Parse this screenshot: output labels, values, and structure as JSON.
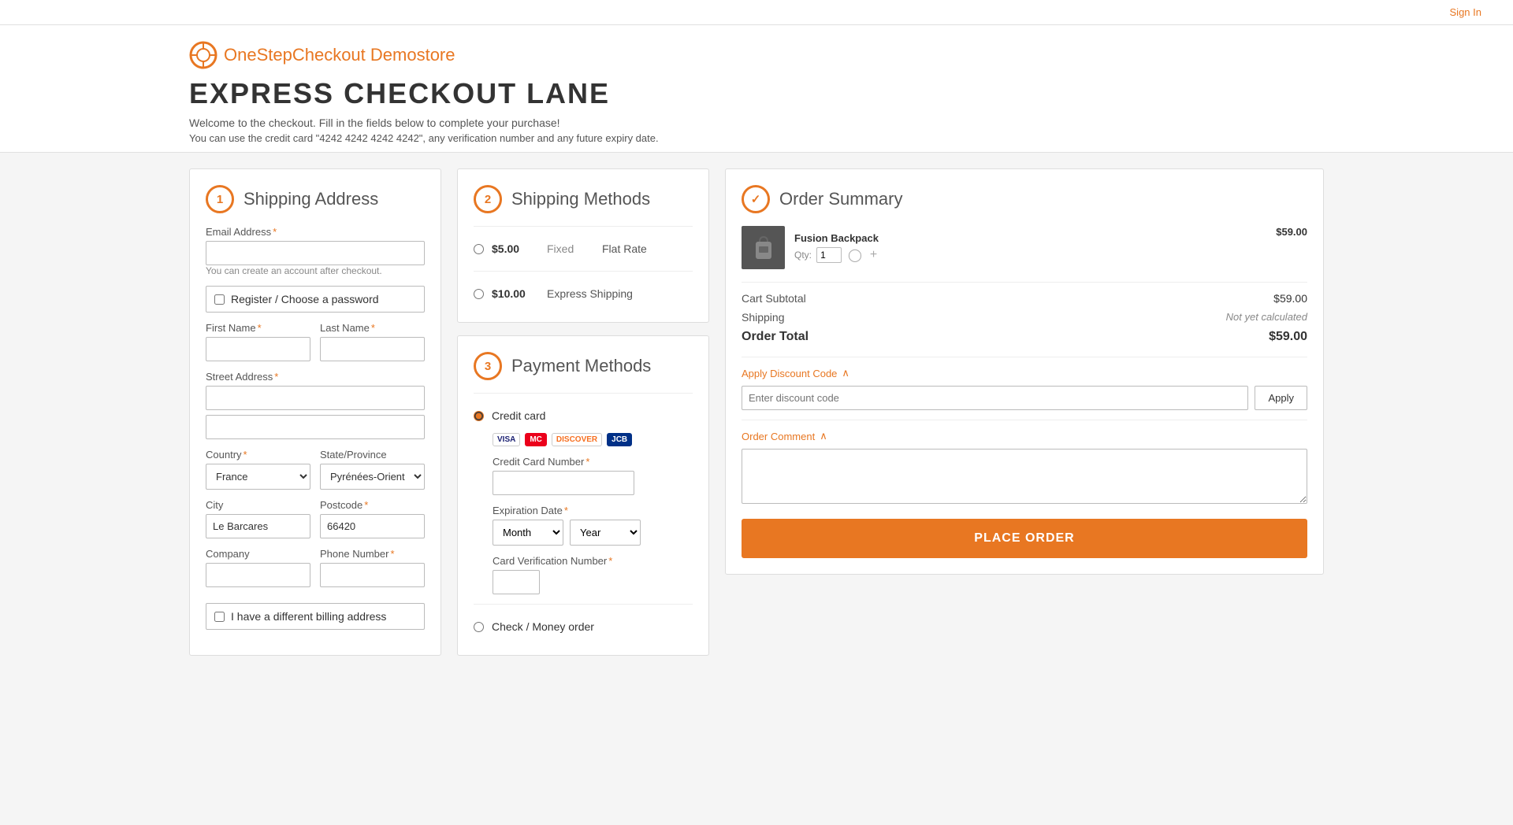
{
  "topbar": {
    "sign_in": "Sign In"
  },
  "header": {
    "logo_brand": "OneStepCheckout",
    "logo_store": " Demostore",
    "page_title": "EXPRESS CHECKOUT LANE",
    "subtitle": "Welcome to the checkout. Fill in the fields below to complete your purchase!",
    "note": "You can use the credit card \"4242 4242 4242 4242\", any verification number and any future expiry date."
  },
  "shipping_address": {
    "step": "1",
    "title": "Shipping Address",
    "email_label": "Email Address",
    "email_placeholder": "",
    "email_hint": "You can create an account after checkout.",
    "register_label": "Register / Choose a password",
    "first_name_label": "First Name",
    "last_name_label": "Last Name",
    "street_label": "Street Address",
    "country_label": "Country",
    "country_value": "France",
    "state_label": "State/Province",
    "state_value": "Pyrénées-Orientales",
    "city_label": "City",
    "city_value": "Le Barcares",
    "postcode_label": "Postcode",
    "postcode_value": "66420",
    "company_label": "Company",
    "phone_label": "Phone Number",
    "billing_label": "I have a different billing address"
  },
  "shipping_methods": {
    "step": "2",
    "title": "Shipping Methods",
    "options": [
      {
        "price": "$5.00",
        "type": "Fixed",
        "name": "Flat Rate"
      },
      {
        "price": "$10.00",
        "type": "",
        "name": "Express Shipping"
      }
    ]
  },
  "payment_methods": {
    "step": "3",
    "title": "Payment Methods",
    "credit_card_label": "Credit card",
    "cc_logos": [
      "VISA",
      "MC",
      "DISC",
      "JCB"
    ],
    "cc_number_label": "Credit Card Number",
    "exp_date_label": "Expiration Date",
    "month_placeholder": "Month",
    "year_placeholder": "Year",
    "cvv_label": "Card Verification Number",
    "check_label": "Check / Money order"
  },
  "order_summary": {
    "step_icon": "✓",
    "title": "Order Summary",
    "product_name": "Fusion Backpack",
    "product_qty": "1",
    "product_price": "$59.00",
    "cart_subtotal_label": "Cart Subtotal",
    "cart_subtotal_value": "$59.00",
    "shipping_label": "Shipping",
    "shipping_value": "Not yet calculated",
    "order_total_label": "Order Total",
    "order_total_value": "$59.00",
    "discount_toggle": "Apply Discount Code",
    "discount_placeholder": "Enter discount code",
    "apply_label": "Apply",
    "comment_toggle": "Order Comment",
    "place_order_label": "PLACE ORDER"
  }
}
